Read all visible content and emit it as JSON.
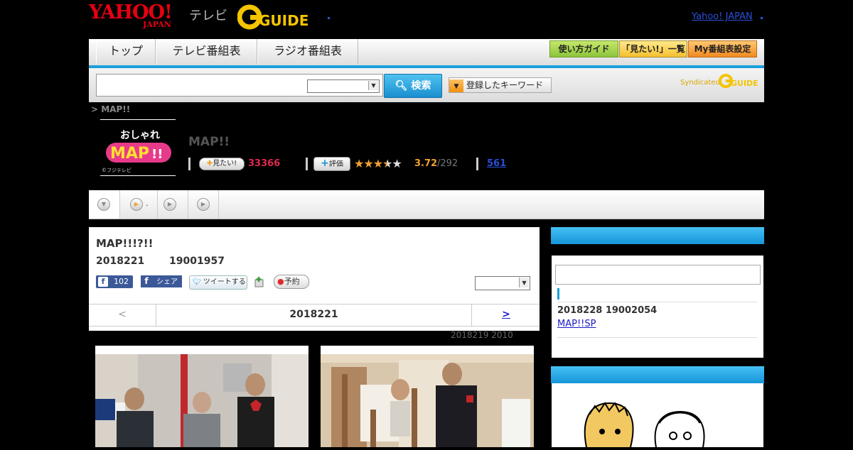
{
  "header": {
    "yahoo_logo": "YAHOO!",
    "yahoo_logo_sub": "JAPAN",
    "tv_label": "テレビ",
    "gguide_logo": "G-GUIDE",
    "yahoo_japan_link": "Yahoo! JAPAN"
  },
  "nav": {
    "tabs": [
      {
        "label": "トップ"
      },
      {
        "label": "テレビ番組表"
      },
      {
        "label": "ラジオ番組表"
      }
    ],
    "buttons": [
      {
        "label": "使い方ガイド"
      },
      {
        "label": "「見たい!」一覧"
      },
      {
        "label": "My番組表設定"
      }
    ]
  },
  "search": {
    "input_value": "",
    "select_value": "",
    "button_label": "検索",
    "keyword_button": "登録したキーワード",
    "syndicated": "Syndicated"
  },
  "breadcrumb": "> MAP!!",
  "program": {
    "logo_text": "おしゃれMAP!!",
    "logo_credit": "©フジテレビ",
    "title": "MAP!!",
    "mitai_label": "見たい!",
    "mitai_count": "33366",
    "rating_label": "評価",
    "rating_value": "3.72",
    "rating_count": "/292",
    "rating_stars": 3.72,
    "review_count": "561"
  },
  "tabs_strip": {
    "tab2_suffix": "."
  },
  "episode": {
    "title": "MAP!!!?!!",
    "date": "2018221",
    "time": "19001957",
    "fb_like_count": "102",
    "fb_share": "シェア",
    "tweet": "ツイートする",
    "record": "予約",
    "select_value": "",
    "pager_prev": "<",
    "pager_current": "2018221",
    "pager_next": ">",
    "prev_broadcast": "2018219  2010"
  },
  "sidebar": {
    "next_date": "2018228  19002054",
    "next_link": "MAP!!SP"
  },
  "colors": {
    "accent_blue": "#1aa0dc",
    "yahoo_red": "#e60012",
    "mitai_pink": "#e0294f",
    "rating_orange": "#f0a030",
    "gguide_yellow": "#f5c400"
  }
}
